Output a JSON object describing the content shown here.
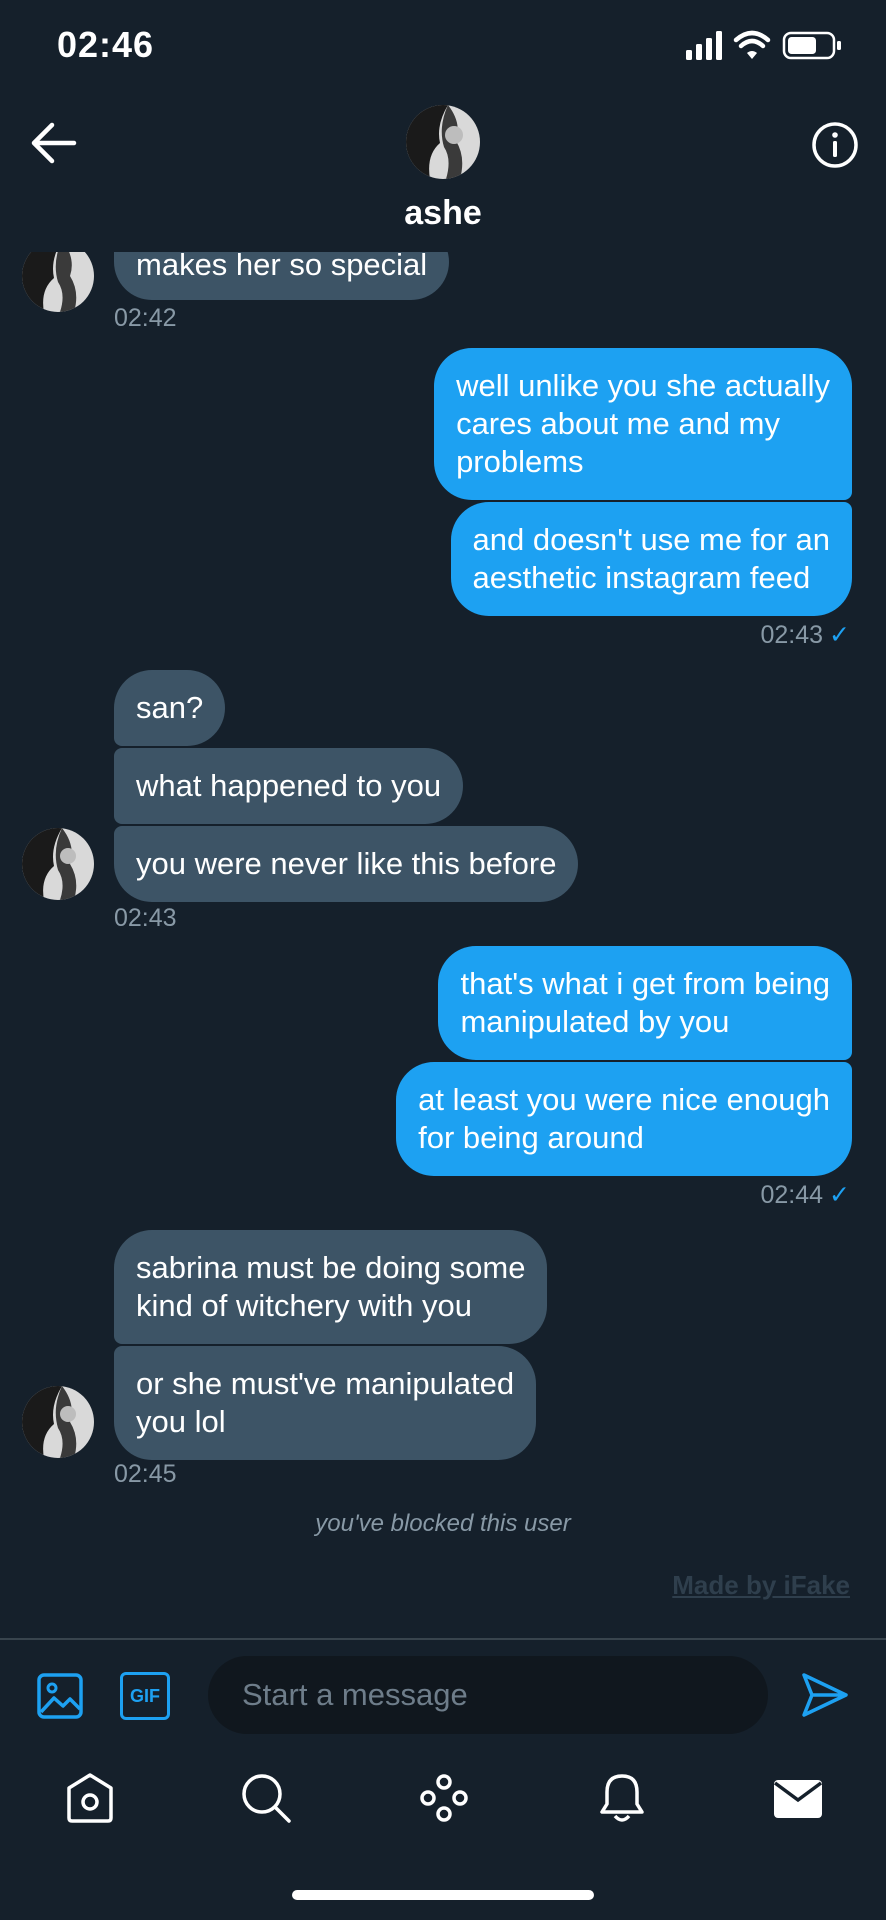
{
  "status": {
    "time": "02:46",
    "icons": [
      "signal-icon",
      "wifi-icon",
      "battery-icon"
    ]
  },
  "header": {
    "name": "ashe",
    "back_icon": "arrow-left-icon",
    "info_icon": "info-icon"
  },
  "messages": {
    "m0": "makes her so special",
    "t0": "02:42",
    "m1": [
      "well unlike you she actually",
      "cares about me and my",
      "problems"
    ],
    "m2": [
      "and doesn't use me for an",
      "aesthetic instagram feed"
    ],
    "t1": "02:43",
    "m3": "san?",
    "m4": "what happened to you",
    "m5": "you were never like this before",
    "t2": "02:43",
    "m6": [
      "that's what i get from being",
      "manipulated by you"
    ],
    "m7": [
      "at least you were nice enough",
      "for being around"
    ],
    "t3": "02:44",
    "m8": [
      "sabrina must be doing some",
      "kind of witchery with you"
    ],
    "m9": [
      "or she must've manipulated",
      "you lol"
    ],
    "t4": "02:45",
    "check": "✓"
  },
  "notice": {
    "blocked": "you've blocked this user",
    "watermark": "Made by iFake"
  },
  "composer": {
    "placeholder": "Start a message",
    "gif_label": "GIF",
    "image_icon": "image-icon",
    "send_icon": "send-icon"
  },
  "nav": {
    "items": [
      "home-icon",
      "search-icon",
      "spaces-icon",
      "notifications-icon",
      "messages-icon"
    ]
  },
  "colors": {
    "background": "#15202b",
    "incoming_bubble": "#3d5466",
    "outgoing_bubble": "#1da1f2",
    "accent": "#1da1f2",
    "muted_text": "#8899a6"
  }
}
